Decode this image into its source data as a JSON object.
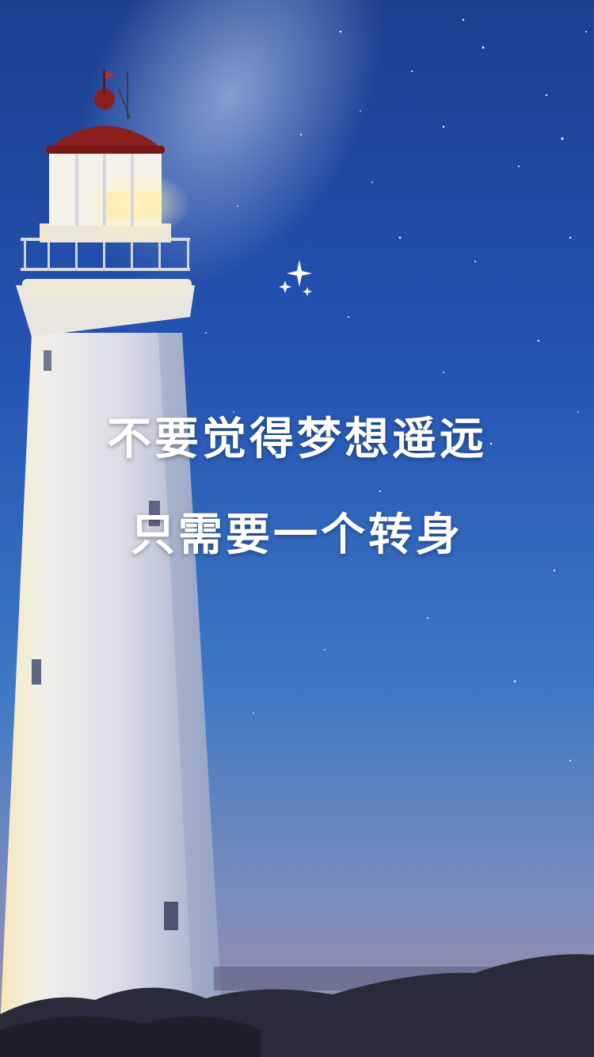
{
  "quote": {
    "line1": "不要觉得梦想遥远",
    "line2": "只需要一个转身"
  },
  "icons": {
    "sparkle": "sparkle-icon"
  },
  "colors": {
    "sky_top": "#1c3f8f",
    "sky_mid": "#2f6fc7",
    "sky_bottom": "#8d8fb8",
    "lighthouse_body": "#e4e7ef",
    "lighthouse_roof": "#8b1e1e",
    "lamp_glow": "#ffe9a6",
    "text": "#ffffff"
  }
}
